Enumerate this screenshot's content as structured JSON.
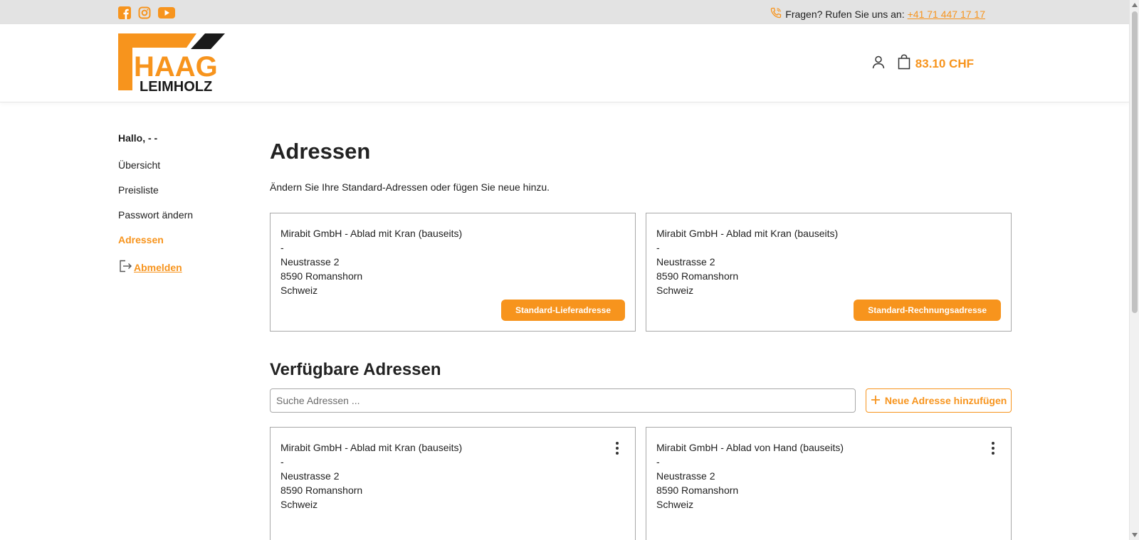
{
  "topbar": {
    "social_icons": [
      "facebook-icon",
      "instagram-icon",
      "youtube-icon"
    ],
    "phone_prefix": "Fragen? Rufen Sie uns an:",
    "phone_number": "+41 71 447 17 17"
  },
  "header": {
    "logo_word1": "HAAG",
    "logo_word2": "LEIMHOLZ",
    "cart_total": "83.10 CHF"
  },
  "colors": {
    "accent": "#f7941d",
    "topbar_bg": "#e3e3e3",
    "text": "#1f1f1f"
  },
  "sidebar": {
    "greeting": "Hallo, - -",
    "items": [
      {
        "label": "Übersicht",
        "active": false
      },
      {
        "label": "Preisliste",
        "active": false
      },
      {
        "label": "Passwort ändern",
        "active": false
      },
      {
        "label": "Adressen",
        "active": true
      }
    ],
    "logout_label": "Abmelden"
  },
  "main": {
    "title": "Adressen",
    "intro": "Ändern Sie Ihre Standard-Adressen oder fügen Sie neue hinzu.",
    "standard_cards": [
      {
        "name": "Mirabit GmbH - Ablad mit Kran (bauseits)",
        "line2": "-",
        "street": "Neustrasse 2",
        "city": "8590 Romanshorn",
        "country": "Schweiz",
        "badge": "Standard-Lieferadresse"
      },
      {
        "name": "Mirabit GmbH - Ablad mit Kran (bauseits)",
        "line2": "-",
        "street": "Neustrasse 2",
        "city": "8590 Romanshorn",
        "country": "Schweiz",
        "badge": "Standard-Rechnungsadresse"
      }
    ],
    "available_title": "Verfügbare Adressen",
    "search_placeholder": "Suche Adressen ...",
    "add_button": "Neue Adresse hinzufügen",
    "available_cards": [
      {
        "name": "Mirabit GmbH - Ablad mit Kran (bauseits)",
        "line2": "-",
        "street": "Neustrasse 2",
        "city": "8590 Romanshorn",
        "country": "Schweiz"
      },
      {
        "name": "Mirabit GmbH - Ablad von Hand (bauseits)",
        "line2": "-",
        "street": "Neustrasse 2",
        "city": "8590 Romanshorn",
        "country": "Schweiz"
      }
    ]
  }
}
